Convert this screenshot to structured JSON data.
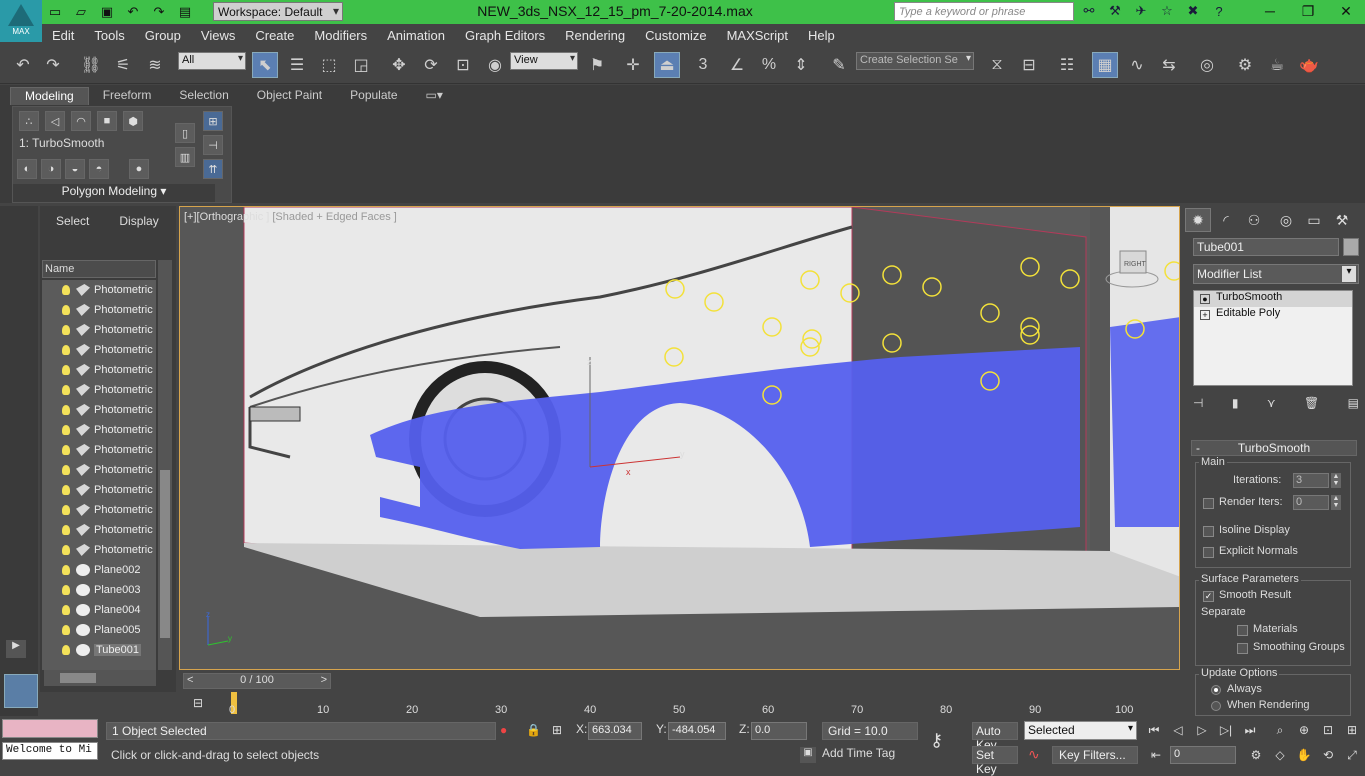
{
  "app": {
    "logo_text": "MAX",
    "document_title": "NEW_3ds_NSX_12_15_pm_7-20-2014.max",
    "workspace": "Workspace: Default",
    "search_placeholder": "Type a keyword or phrase"
  },
  "menu": [
    "Edit",
    "Tools",
    "Group",
    "Views",
    "Create",
    "Modifiers",
    "Animation",
    "Graph Editors",
    "Rendering",
    "Customize",
    "MAXScript",
    "Help"
  ],
  "toolbar": {
    "selection_filter": "All",
    "ref_coord": "View",
    "snap_angle": "3",
    "named_selection_placeholder": "Create Selection Se"
  },
  "ribbon": {
    "tabs": [
      "Modeling",
      "Freeform",
      "Selection",
      "Object Paint",
      "Populate"
    ],
    "active_tab": "Modeling",
    "modifier_label": "1: TurboSmooth",
    "panel_title": "Polygon Modeling"
  },
  "scene_explorer": {
    "tabs": [
      "Select",
      "Display"
    ],
    "column_header": "Name",
    "items": [
      {
        "name": "Photometric"
      },
      {
        "name": "Photometric"
      },
      {
        "name": "Photometric"
      },
      {
        "name": "Photometric"
      },
      {
        "name": "Photometric"
      },
      {
        "name": "Photometric"
      },
      {
        "name": "Photometric"
      },
      {
        "name": "Photometric"
      },
      {
        "name": "Photometric"
      },
      {
        "name": "Photometric"
      },
      {
        "name": "Photometric"
      },
      {
        "name": "Photometric"
      },
      {
        "name": "Photometric"
      },
      {
        "name": "Photometric"
      },
      {
        "name": "Plane002"
      },
      {
        "name": "Plane003"
      },
      {
        "name": "Plane004"
      },
      {
        "name": "Plane005"
      },
      {
        "name": "Tube001"
      }
    ],
    "selected_item": "Tube001"
  },
  "viewport": {
    "label_bracket": "[+]",
    "label_view": "[Orthographic ]",
    "label_shading": "[Shaded + Edged Faces ]",
    "viewcube_label": "RIGHT",
    "axis_x": "x",
    "axis_y": "y",
    "axis_z": "z"
  },
  "command_panel": {
    "object_name": "Tube001",
    "modifier_list": "Modifier List",
    "stack": [
      {
        "name": "TurboSmooth",
        "icon": "light-bulb-icon"
      },
      {
        "name": "Editable Poly",
        "icon": "plus-icon"
      }
    ],
    "rollout_title": "TurboSmooth",
    "main_group": "Main",
    "iterations_label": "Iterations:",
    "iterations_value": "3",
    "render_iters_label": "Render Iters:",
    "render_iters_value": "0",
    "render_iters_checked": false,
    "isoline_display": "Isoline Display",
    "explicit_normals": "Explicit Normals",
    "surface_params": "Surface Parameters",
    "smooth_result": "Smooth Result",
    "smooth_result_checked": true,
    "separate": "Separate",
    "materials": "Materials",
    "smoothing_groups": "Smoothing Groups",
    "update_options": "Update Options",
    "always": "Always",
    "when_rendering": "When Rendering"
  },
  "timeline": {
    "slider": "0 / 100",
    "ticks": [
      "0",
      "10",
      "20",
      "30",
      "40",
      "50",
      "60",
      "70",
      "80",
      "90",
      "100"
    ]
  },
  "status": {
    "selection": "1 Object Selected",
    "prompt": "Click or click-and-drag to select objects",
    "welcome": "Welcome to Mi",
    "x_label": "X:",
    "x": "663.034",
    "y_label": "Y:",
    "y": "-484.054",
    "z_label": "Z:",
    "z": "0.0",
    "grid": "Grid = 10.0",
    "add_time_tag": "Add Time Tag",
    "auto_key": "Auto Key",
    "set_key": "Set Key",
    "selected": "Selected",
    "key_filters": "Key Filters...",
    "frame": "0"
  },
  "colors": {
    "title_bar": "#3ec149",
    "mesh": "#5560ee",
    "light_gizmo": "#f3e13a",
    "viewport_border": "#d6a44d"
  }
}
